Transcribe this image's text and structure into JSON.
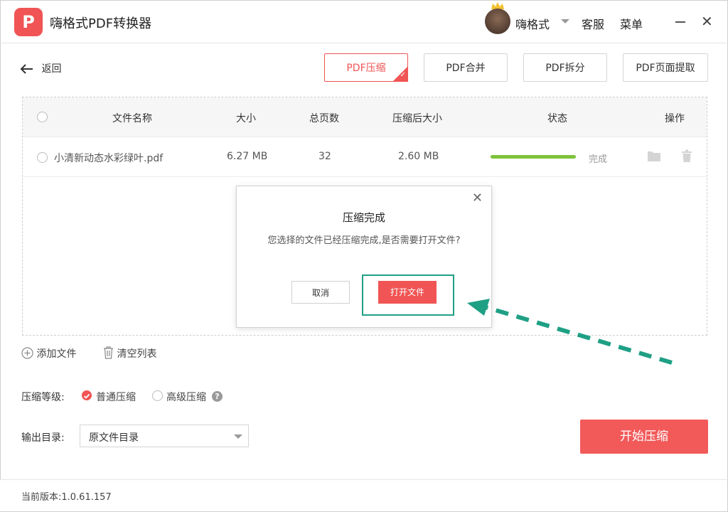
{
  "app": {
    "logo_letter": "P",
    "title": "嗨格式PDF转换器"
  },
  "user": {
    "name": "嗨格式"
  },
  "topbar": {
    "service": "客服",
    "menu": "菜单",
    "close_glyph": "✕"
  },
  "back": {
    "label": "返回"
  },
  "tabs": [
    {
      "label": "PDF压缩",
      "active": true
    },
    {
      "label": "PDF合并",
      "active": false
    },
    {
      "label": "PDF拆分",
      "active": false
    },
    {
      "label": "PDF页面提取",
      "active": false
    }
  ],
  "table": {
    "headers": {
      "name": "文件名称",
      "size": "大小",
      "pages": "总页数",
      "compressed": "压缩后大小",
      "status": "状态",
      "actions": "操作"
    },
    "rows": [
      {
        "name": "小清新动态水彩绿叶.pdf",
        "size": "6.27 MB",
        "pages": "32",
        "compressed": "2.60 MB",
        "status": "完成",
        "progress": 1.0
      }
    ]
  },
  "dialog": {
    "title": "压缩完成",
    "message": "您选择的文件已经压缩完成,是否需要打开文件?",
    "cancel": "取消",
    "open": "打开文件",
    "close_glyph": "✕"
  },
  "actions": {
    "add": "添加文件",
    "clear": "清空列表"
  },
  "level": {
    "label": "压缩等级:",
    "options": [
      {
        "label": "普通压缩",
        "selected": true
      },
      {
        "label": "高级压缩",
        "selected": false
      }
    ],
    "help": "?"
  },
  "output": {
    "label": "输出目录:",
    "value": "原文件目录"
  },
  "start": {
    "label": "开始压缩"
  },
  "footer": {
    "version": "当前版本:1.0.61.157"
  },
  "colors": {
    "accent": "#f05454",
    "success": "#7ec33a",
    "highlight": "#1fa085"
  }
}
